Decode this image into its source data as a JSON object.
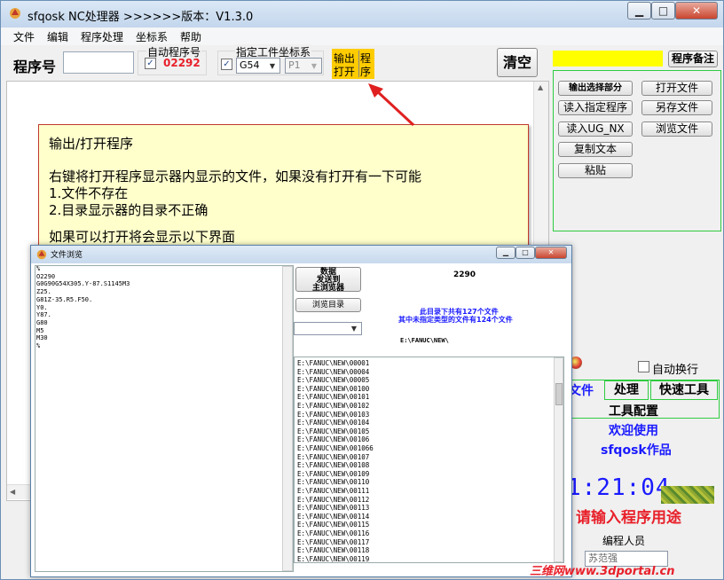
{
  "window": {
    "title": "sfqosk NC处理器 >>>>>>版本：V1.3.0",
    "min": "▁",
    "max": "□",
    "close": "✕"
  },
  "menu": [
    "文件",
    "编辑",
    "程序处理",
    "坐标系",
    "帮助"
  ],
  "toolbar": {
    "program_no_label": "程序号",
    "program_no_value": "",
    "auto_label": "自动程序号",
    "auto_checked": "✓",
    "auto_value": "02292",
    "wcs_label": "指定工件坐标系",
    "wcs_checked": "✓",
    "wcs_value": "G54",
    "wcs2_value": "P1",
    "output_open_1": "输出",
    "output_open_2": "打开",
    "program_1": "程",
    "program_2": "序",
    "clear": "清空"
  },
  "right": {
    "note_button": "程序备注",
    "buttons_left": [
      "输出选择部分",
      "读入指定程序",
      "读入UG_NX",
      "复制文本",
      "粘贴"
    ],
    "buttons_right": [
      "打开文件",
      "另存文件",
      "浏览文件"
    ],
    "auto_wrap": "自动换行",
    "tab_file": "文件",
    "tab_process": "处理",
    "tab_quick": "快速工具",
    "tool_config": "工具配置",
    "welcome": "欢迎使用",
    "author": "sfqosk作品",
    "clock": "1:21:04",
    "purpose": "请输入程序用途",
    "programmer_label": "编程人员",
    "programmer_value": "苏范强"
  },
  "callout": {
    "title": "输出/打开程序",
    "line1": "右键将打开程序显示器内显示的文件，如果没有打开有一下可能",
    "line2": "1.文件不存在",
    "line3": "2.目录显示器的目录不正确",
    "line4": "如果可以打开将会显示以下界面"
  },
  "browser": {
    "title": "文件浏览",
    "code": "%\nO2290\nG0G90G54X305.Y-87.S1145M3\nZ25.\nG81Z-35.R5.F50.\nY0.\nY87.\nG80\nM5\nM30\n%",
    "send_btn_1": "数据",
    "send_btn_2": "发送到",
    "send_btn_3": "主浏览器",
    "browse_dir": "浏览目录",
    "filter_value": "",
    "number": "2290",
    "info1": "此目录下共有127个文件",
    "info2": "其中未指定类型的文件有124个文件",
    "dir": "E:\\FANUC\\NEW\\",
    "files": [
      "E:\\FANUC\\NEW\\00001",
      "E:\\FANUC\\NEW\\00004",
      "E:\\FANUC\\NEW\\00005",
      "E:\\FANUC\\NEW\\00100",
      "E:\\FANUC\\NEW\\00101",
      "E:\\FANUC\\NEW\\00102",
      "E:\\FANUC\\NEW\\00103",
      "E:\\FANUC\\NEW\\00104",
      "E:\\FANUC\\NEW\\00105",
      "E:\\FANUC\\NEW\\00106",
      "E:\\FANUC\\NEW\\001066",
      "E:\\FANUC\\NEW\\00107",
      "E:\\FANUC\\NEW\\00108",
      "E:\\FANUC\\NEW\\00109",
      "E:\\FANUC\\NEW\\00110",
      "E:\\FANUC\\NEW\\00111",
      "E:\\FANUC\\NEW\\00112",
      "E:\\FANUC\\NEW\\00113",
      "E:\\FANUC\\NEW\\00114",
      "E:\\FANUC\\NEW\\00115",
      "E:\\FANUC\\NEW\\00116",
      "E:\\FANUC\\NEW\\00117",
      "E:\\FANUC\\NEW\\00118",
      "E:\\FANUC\\NEW\\00119"
    ]
  },
  "watermark": "三维网www.3dportal.cn",
  "colors": {
    "accent_yellow": "#ffcc00",
    "callout_bg": "#ffffcc",
    "arrow": "#e02020",
    "panel_green": "#2ecc40",
    "text_blue": "#1a1aff",
    "text_red": "#e8202a"
  }
}
